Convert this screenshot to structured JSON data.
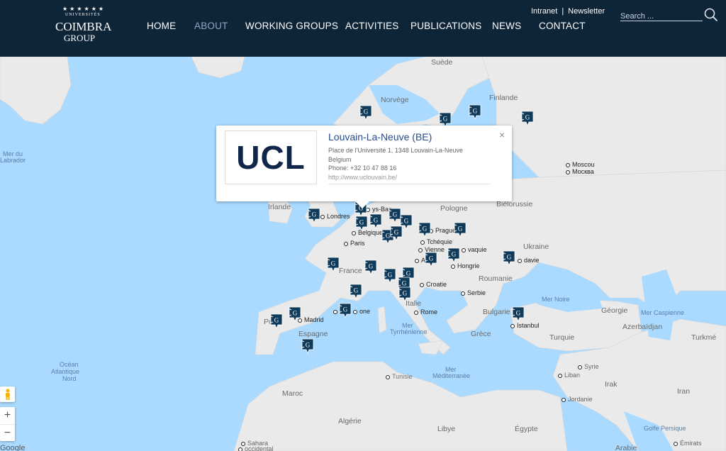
{
  "header": {
    "logo": {
      "stars": "★★★★★★",
      "text_top": "UNIVERSITÉS",
      "mark_line1": "COIMBRA",
      "mark_line2": "GROUP"
    },
    "nav": [
      {
        "label": "HOME",
        "active": false
      },
      {
        "label": "ABOUT",
        "active": true
      },
      {
        "label": "WORKING GROUPS",
        "active": false
      },
      {
        "label": "ACTIVITIES",
        "active": false
      },
      {
        "label": "PUBLICATIONS",
        "active": false
      },
      {
        "label": "NEWS",
        "active": false
      },
      {
        "label": "CONTACT",
        "active": false
      }
    ],
    "toplinks": {
      "intranet": "Intranet",
      "separator": "|",
      "newsletter": "Newsletter"
    },
    "search": {
      "placeholder": "Search ...",
      "value": ""
    }
  },
  "popup": {
    "logo_text": "UCL",
    "title": "Louvain-La-Neuve (BE)",
    "address_line1": "Place de l'Université 1, 1348 Louvain-La-Neuve",
    "address_line2": "Belgium",
    "phone": "Phone: +32 10 47 88 16",
    "url": "http://www.uclouvain.be/",
    "close": "×"
  },
  "map": {
    "labels": {
      "suede": "Suède",
      "norvege": "Norvège",
      "finlande": "Finlande",
      "mer_labrador_1": "Mer du",
      "mer_labrador_2": "Labrador",
      "moscou": "Moscou",
      "moscou_ru": "Москва",
      "irlande": "Irlande",
      "londres": "Londres",
      "pays_bas": "ys-Bas",
      "belgique": "Belgique",
      "pologne": "Pologne",
      "bielorussie": "Biélorussie",
      "paris": "Paris",
      "prague": "Prague",
      "tcheque": "Tchéquie",
      "vienne": "Vienne",
      "ukraine": "Ukraine",
      "france": "France",
      "autriche": "Aut",
      "hongrie": "Hongrie",
      "slovaquie": "vaquie",
      "moldavie": "davie",
      "roumanie": "Roumanie",
      "croatie": "Croatie",
      "serbie": "Serbie",
      "mer_noire": "Mer Noire",
      "georgie": "Géorgie",
      "mer_caspienne": "Mer Caspienne",
      "azerbaidjan": "Azerbaïdjan",
      "turkmenistan": "Turkmé",
      "portugal": "Po",
      "madrid": "Madrid",
      "espagne": "Espagne",
      "barcelone": "Ba",
      "barcelone2": "one",
      "italie": "Italie",
      "rome": "Rome",
      "bulgarie": "Bulgarie",
      "istanbul": "Istanbul",
      "turquie": "Turquie",
      "grece": "Grèce",
      "mer_tyrrhenienne_1": "Mer",
      "mer_tyrrhenienne_2": "Tyrrhénienne",
      "ocean_1": "Océan",
      "ocean_2": "Atlantique",
      "ocean_3": "Nord",
      "tunisie": "Tunisie",
      "mer_med_1": "Mer",
      "mer_med_2": "Méditerranée",
      "syrie": "Syrie",
      "liban": "Liban",
      "irak": "Irak",
      "iran": "Iran",
      "jordanie": "Jordanie",
      "maroc": "Maroc",
      "algerie": "Algérie",
      "libye": "Libye",
      "egypte": "Égypte",
      "golfe": "Golfe Persique",
      "sahara_1": "Sahara",
      "sahara_2": "occidental",
      "arabie": "Arabie",
      "emirats": "Émirats",
      "google": "Google"
    },
    "marker_icon": "coimbra-group-marker-icon"
  },
  "controls": {
    "zoom_in": "+",
    "zoom_out": "−"
  },
  "colors": {
    "header_bg": "#0e2437",
    "water": "#aadaff",
    "land": "#eaeaea",
    "marker": "#0f3a5a",
    "popup_title": "#274b8c"
  }
}
